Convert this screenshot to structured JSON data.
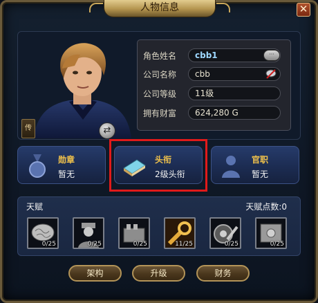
{
  "window": {
    "title": "人物信息",
    "close_glyph": "✕"
  },
  "character": {
    "rank_tab": "传",
    "swap_glyph": "⇄",
    "fields": [
      {
        "label": "角色姓名",
        "value": "cbb1"
      },
      {
        "label": "公司名称",
        "value": "cbb"
      },
      {
        "label": "公司等级",
        "value": "11级"
      },
      {
        "label": "拥有财富",
        "value": "624,280 G"
      }
    ],
    "chat_glyph": "···"
  },
  "cards": [
    {
      "title": "勋章",
      "value": "暂无",
      "icon": "medal-icon"
    },
    {
      "title": "头衔",
      "value": "2级头衔",
      "icon": "title-book-icon",
      "highlighted": true
    },
    {
      "title": "官职",
      "value": "暂无",
      "icon": "official-person-icon"
    }
  ],
  "talents": {
    "title": "天赋",
    "points_label": "天赋点数:0",
    "items": [
      {
        "icon": "brain-icon",
        "count": "0/25"
      },
      {
        "icon": "worker-icon",
        "count": "0/25"
      },
      {
        "icon": "engine-icon",
        "count": "0/25"
      },
      {
        "icon": "golden-wrench-icon",
        "count": "11/25"
      },
      {
        "icon": "tire-wrench-icon",
        "count": "0/25"
      },
      {
        "icon": "safe-icon",
        "count": "0/25"
      }
    ]
  },
  "buttons": {
    "structure": "架构",
    "upgrade": "升级",
    "finance": "财务"
  },
  "colors": {
    "accent_gold": "#f1c24b",
    "highlight_red": "#e01a1a",
    "card_blue": "#263b6a"
  }
}
